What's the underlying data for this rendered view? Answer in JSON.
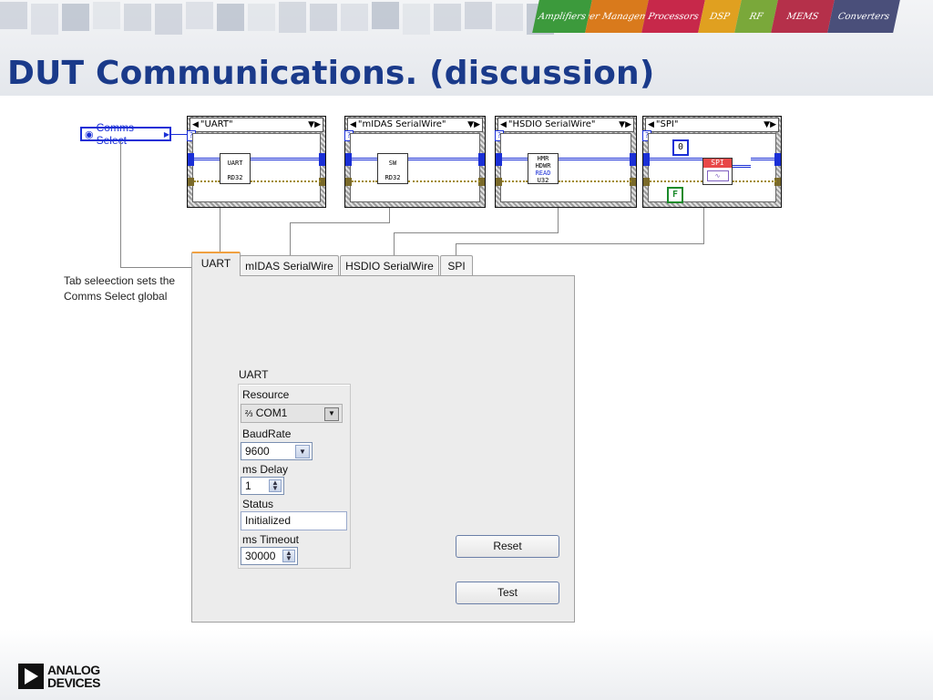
{
  "slide": {
    "title": "DUT Communications. (discussion)",
    "banner": [
      "Amplifiers",
      "Power Management",
      "Processors",
      "DSP",
      "RF",
      "MEMS",
      "Converters"
    ],
    "footer_logo": [
      "ANALOG",
      "DEVICES"
    ]
  },
  "diagram": {
    "global_label": "Comms Select",
    "cases": [
      {
        "selector": "\"UART\"",
        "subvi": [
          "UART",
          "RD32"
        ]
      },
      {
        "selector": "\"mIDAS SerialWire\"",
        "subvi": [
          "SW",
          "RD32"
        ]
      },
      {
        "selector": "\"HSDIO SerialWire\"",
        "subvi": [
          "HMR",
          "HDWR",
          "READ",
          "U32"
        ]
      },
      {
        "selector": "\"SPI\"",
        "subvi": [
          "SPI"
        ],
        "const_num": "0",
        "const_bool": "F"
      }
    ]
  },
  "note": {
    "line1": "Tab seleection sets the",
    "line2": "Comms Select global"
  },
  "tabs": [
    "UART",
    "mIDAS SerialWire",
    "HSDIO SerialWire",
    "SPI"
  ],
  "uart": {
    "cluster_label": "UART",
    "resource_label": "Resource",
    "resource_value": "COM1",
    "baud_label": "BaudRate",
    "baud_value": "9600",
    "delay_label": "ms Delay",
    "delay_value": "1",
    "status_label": "Status",
    "status_value": "Initialized",
    "timeout_label": "ms Timeout",
    "timeout_value": "30000"
  },
  "buttons": {
    "reset": "Reset",
    "test": "Test"
  }
}
